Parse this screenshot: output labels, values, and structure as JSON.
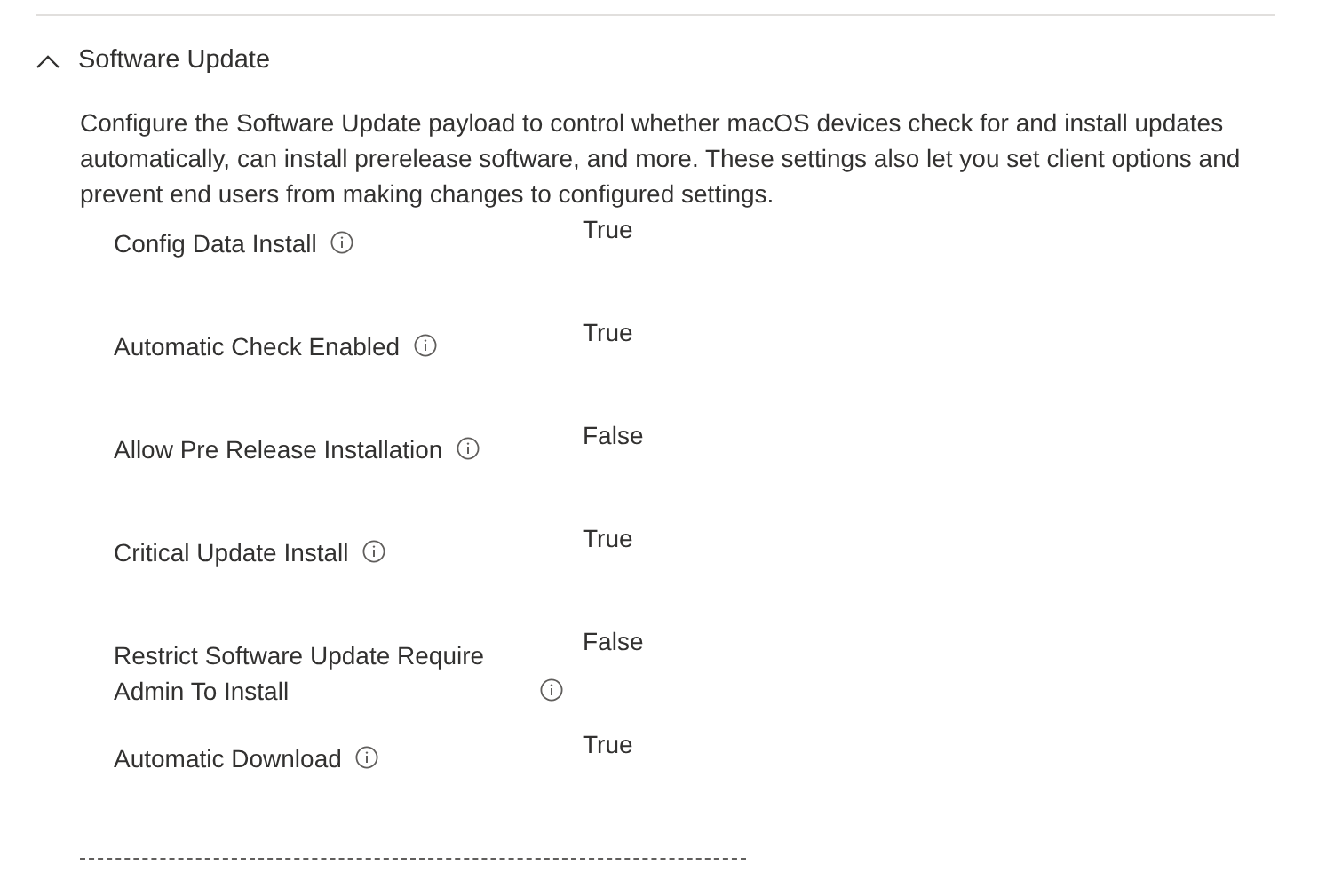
{
  "section": {
    "title": "Software Update",
    "expanded": true,
    "description": "Configure the Software Update payload to control whether macOS devices check for and install updates automatically, can install prerelease software, and more. These settings also let you set client options and prevent end users from making changes to configured settings."
  },
  "settings": [
    {
      "label": "Config Data Install",
      "value": "True"
    },
    {
      "label": "Automatic Check Enabled",
      "value": "True"
    },
    {
      "label": "Allow Pre Release Installation",
      "value": "False"
    },
    {
      "label": "Critical Update Install",
      "value": "True"
    },
    {
      "label": "Restrict Software Update Require Admin To Install",
      "value": "False"
    },
    {
      "label": "Automatic Download",
      "value": "True"
    }
  ]
}
